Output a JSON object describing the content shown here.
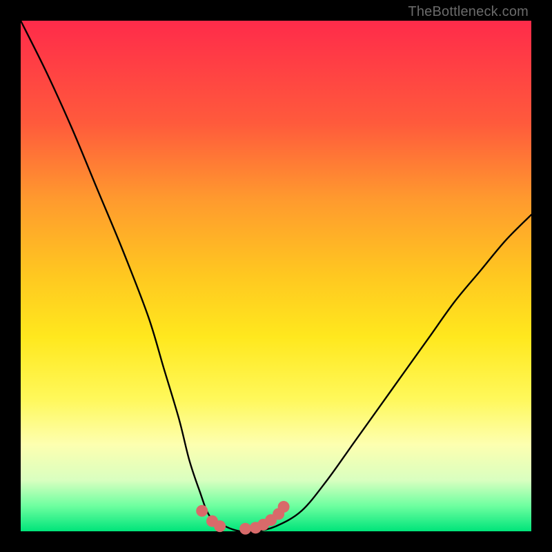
{
  "watermark": "TheBottleneck.com",
  "chart_data": {
    "type": "line",
    "title": "",
    "xlabel": "",
    "ylabel": "",
    "xlim": [
      0,
      100
    ],
    "ylim": [
      0,
      100
    ],
    "series": [
      {
        "name": "bottleneck-curve",
        "x": [
          0,
          5,
          10,
          15,
          20,
          25,
          28,
          31,
          33,
          35,
          37,
          40,
          43,
          46,
          50,
          55,
          60,
          65,
          70,
          75,
          80,
          85,
          90,
          95,
          100
        ],
        "y": [
          100,
          90,
          79,
          67,
          55,
          42,
          32,
          22,
          14,
          8,
          3,
          1,
          0,
          0,
          1,
          4,
          10,
          17,
          24,
          31,
          38,
          45,
          51,
          57,
          62
        ]
      }
    ],
    "highlight_points": {
      "name": "minimum-region-dots",
      "color": "#d86a6a",
      "x": [
        35.5,
        37.5,
        39.0,
        44.0,
        46.0,
        47.5,
        49.0,
        50.5,
        51.5
      ],
      "y": [
        4.0,
        2.0,
        1.0,
        0.5,
        0.7,
        1.3,
        2.2,
        3.4,
        4.8
      ]
    },
    "gradient_stops": [
      {
        "pos": 0,
        "color": "#ff2b4a"
      },
      {
        "pos": 20,
        "color": "#ff5a3c"
      },
      {
        "pos": 35,
        "color": "#ff9a2e"
      },
      {
        "pos": 50,
        "color": "#ffc820"
      },
      {
        "pos": 62,
        "color": "#ffe81e"
      },
      {
        "pos": 74,
        "color": "#fff85a"
      },
      {
        "pos": 83,
        "color": "#fdffb0"
      },
      {
        "pos": 90,
        "color": "#d9ffc0"
      },
      {
        "pos": 95,
        "color": "#6effa0"
      },
      {
        "pos": 100,
        "color": "#00e47a"
      }
    ]
  }
}
